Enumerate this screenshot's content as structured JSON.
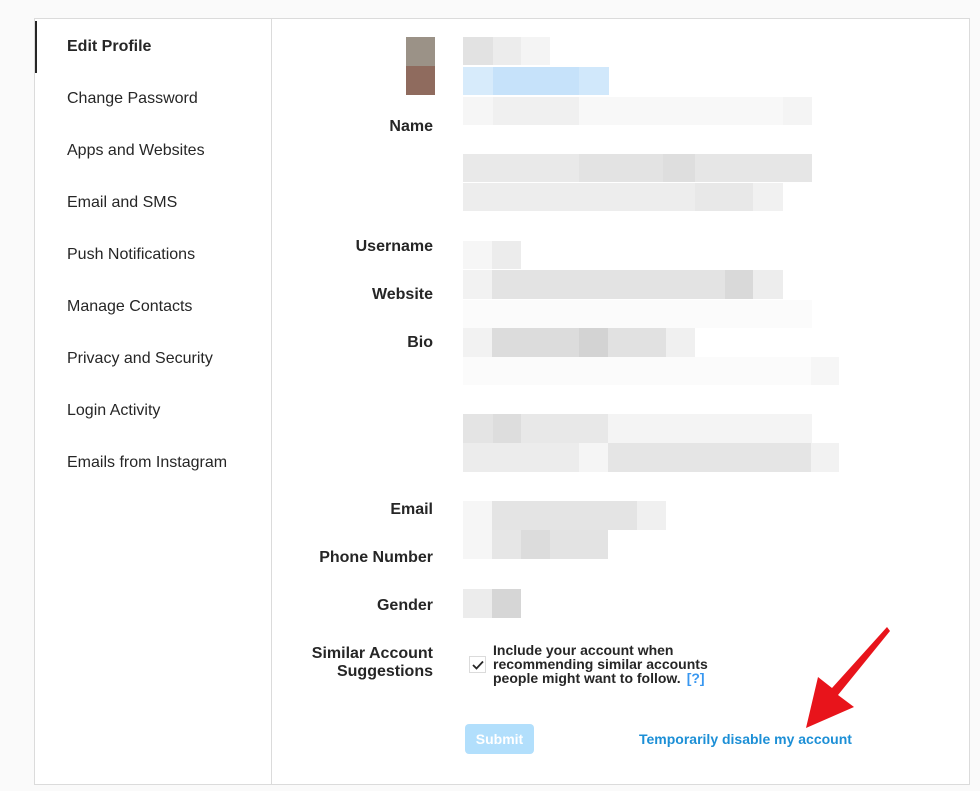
{
  "sidebar": {
    "items": [
      {
        "label": "Edit Profile"
      },
      {
        "label": "Change Password"
      },
      {
        "label": "Apps and Websites"
      },
      {
        "label": "Email and SMS"
      },
      {
        "label": "Push Notifications"
      },
      {
        "label": "Manage Contacts"
      },
      {
        "label": "Privacy and Security"
      },
      {
        "label": "Login Activity"
      },
      {
        "label": "Emails from Instagram"
      }
    ]
  },
  "form": {
    "name_label": "Name",
    "username_label": "Username",
    "website_label": "Website",
    "bio_label": "Bio",
    "email_label": "Email",
    "phone_label": "Phone Number",
    "gender_label": "Gender",
    "similar_label_line1": "Similar Account",
    "similar_label_line2": "Suggestions",
    "similar_checkbox_text": "Include your account when recommending similar accounts people might want to follow.",
    "similar_help": "[?]",
    "similar_checked": true,
    "submit_label": "Submit",
    "disable_link": "Temporarily disable my account"
  },
  "colors": {
    "accent": "#0095f6",
    "submit_disabled": "#b2dffc",
    "annotation_arrow": "#e8141b"
  }
}
